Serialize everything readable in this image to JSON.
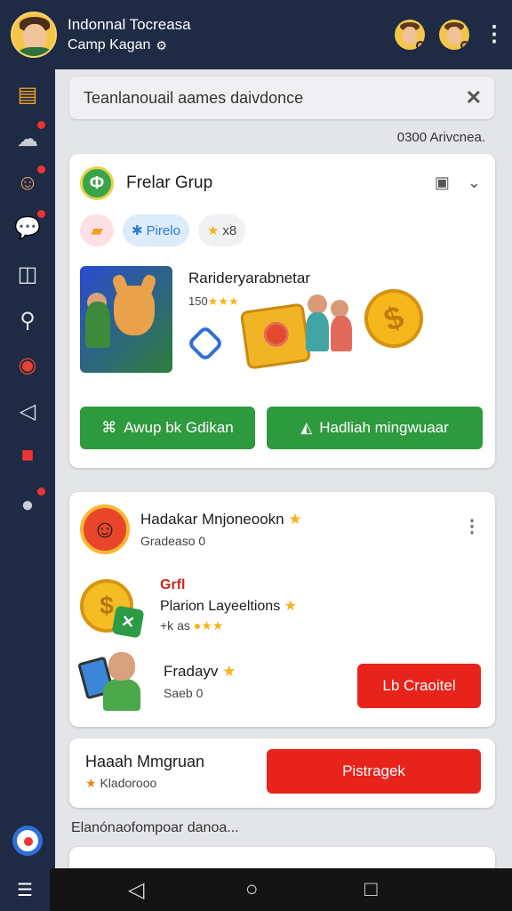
{
  "header": {
    "title": "Indonnal Tocreasa",
    "subtitle": "Camp Kagan"
  },
  "search": {
    "value": "Teanlanouail aames daivdonce",
    "close_label": "✕"
  },
  "results_count": "0300 Arivcnea.",
  "group_card": {
    "title": "Frelar Grup",
    "chips": [
      {
        "label": ""
      },
      {
        "label": "Pirelo"
      },
      {
        "label": "x8"
      }
    ],
    "game_title": "Rarideryarabnetar",
    "game_rating": "150",
    "buttons": {
      "join": "Awup bk Gdikan",
      "reward": "Hadliah mingwuaar"
    }
  },
  "rewards_card": {
    "rows": [
      {
        "title": "Hadakar Mnjoneookn",
        "sub": "Gradeaso 0"
      },
      {
        "title": "Grfl",
        "line2": "Plarion Layeeltions",
        "sub": "+k as"
      },
      {
        "title": "Fradayv",
        "sub": "Saeb 0"
      }
    ],
    "button": "Lb Craoitel"
  },
  "weekly_card": {
    "title": "Haaah Mmgruan",
    "sub": "Kladorooo",
    "button": "Pistragek"
  },
  "section_label": "Elanónaofompoar danoa...",
  "colors": {
    "topbar": "#1f2a44",
    "green": "#2e9a3e",
    "red": "#e7231c",
    "star": "#f3b51c"
  },
  "sidebar_icons": [
    "folder-icon",
    "cloud-icon",
    "avatar-icon",
    "chat-icon",
    "board-icon",
    "search-icon",
    "target-icon",
    "share-icon",
    "gift-icon",
    "bell-icon",
    "ball-icon"
  ]
}
